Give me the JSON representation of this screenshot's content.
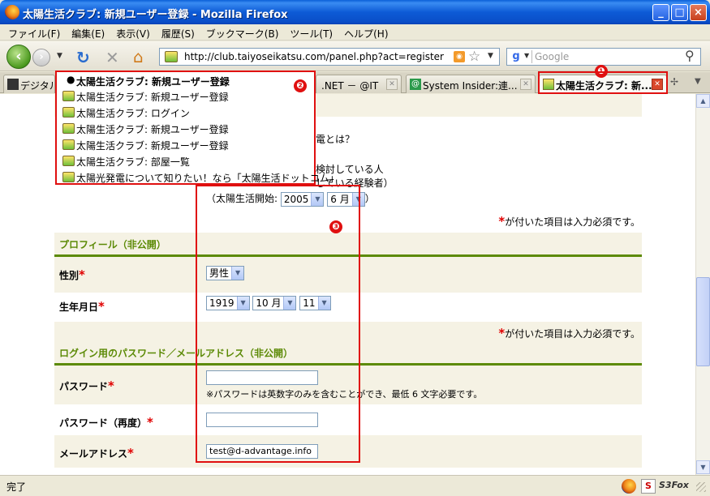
{
  "window": {
    "title": "太陽生活クラブ: 新規ユーザー登録 - Mozilla Firefox",
    "buttons": {
      "minimize": "_",
      "maximize": "□",
      "close": "×"
    }
  },
  "menubar": {
    "items": [
      "ファイル(F)",
      "編集(E)",
      "表示(V)",
      "履歴(S)",
      "ブックマーク(B)",
      "ツール(T)",
      "ヘルプ(H)"
    ]
  },
  "navbar": {
    "url": "http://club.taiyoseikatsu.com/panel.php?act=register",
    "search_placeholder": "Google"
  },
  "tabs": [
    {
      "label": "デジタル"
    },
    {
      "label": ".NET － @IT"
    },
    {
      "label": "System Insider:連..."
    },
    {
      "label": "太陽生活クラブ: 新..."
    }
  ],
  "tab_menu": {
    "items": [
      {
        "label": "太陽生活クラブ: 新規ユーザー登録",
        "current": true
      },
      {
        "label": "太陽生活クラブ: 新規ユーザー登録"
      },
      {
        "label": "太陽生活クラブ: ログイン"
      },
      {
        "label": "太陽生活クラブ: 新規ユーザー登録"
      },
      {
        "label": "太陽生活クラブ: 新規ユーザー登録"
      },
      {
        "label": "太陽生活クラブ: 部屋一覧"
      },
      {
        "label": "太陽光発電について知りたい！なら「太陽生活ドットコム」"
      }
    ]
  },
  "callouts": [
    "❶",
    "❷",
    "❸"
  ],
  "page": {
    "partial_question": "電とは？",
    "partial_option1": "検討している人",
    "partial_option2": "している経験者）",
    "start_label": "（太陽生活開始:",
    "start_year": "2005",
    "start_month": "6 月",
    "start_close": "）",
    "required_note": "が付いた項目は入力必須です。",
    "required_mark": "*",
    "profile_heading": "プロフィール（非公開）",
    "gender_label": "性別",
    "gender_value": "男性",
    "birthdate_label": "生年月日",
    "birth_year": "1919",
    "birth_month": "10 月",
    "birth_day": "11",
    "login_heading": "ログイン用のパスワード／メールアドレス（非公開）",
    "password_label": "パスワード",
    "password_value": "",
    "password_note": "※パスワードは英数字のみを含むことができ、最低 6 文字必要です。",
    "password_confirm_label": "パスワード（再度）",
    "password_confirm_value": "",
    "email_label": "メールアドレス",
    "email_value": "test@d-advantage.info"
  },
  "statusbar": {
    "text": "完了",
    "s3fox": "S3Fox"
  }
}
